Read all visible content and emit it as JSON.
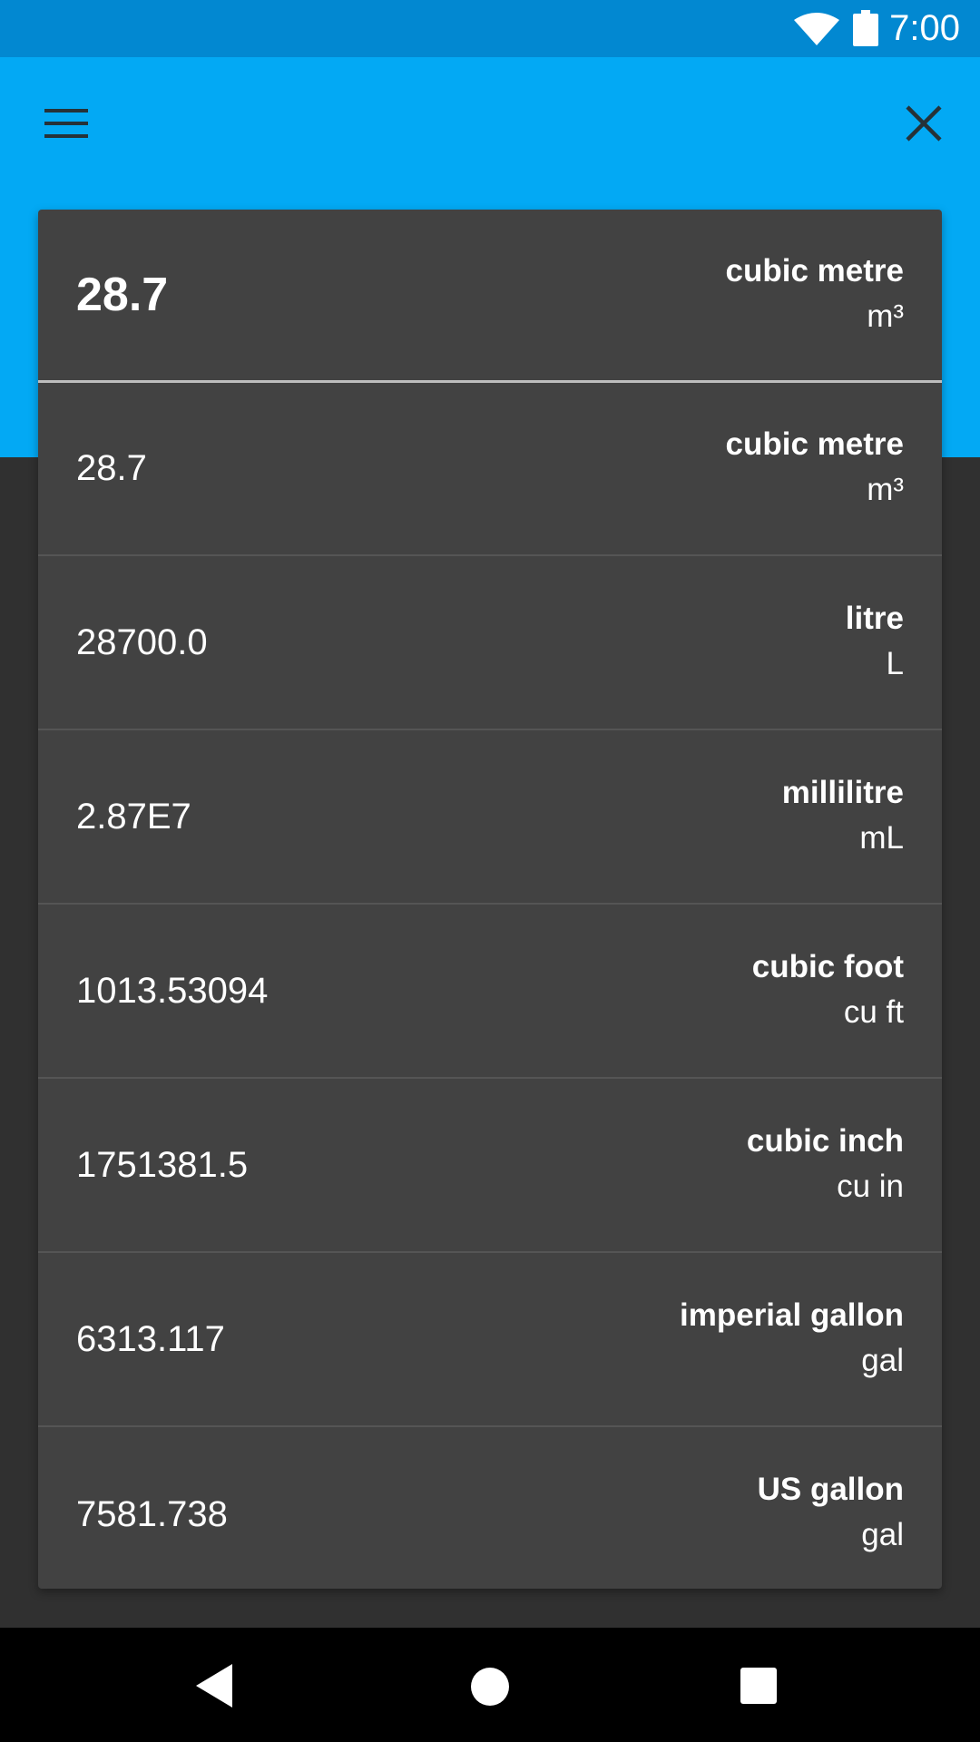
{
  "status_bar": {
    "time": "7:00",
    "icons": [
      "wifi-icon",
      "battery-icon"
    ],
    "color": "#0288D1"
  },
  "app_bar": {
    "color": "#03A9F4",
    "icons": [
      "menu-icon",
      "close-icon"
    ]
  },
  "conversion_input": {
    "value": "28.7",
    "unit_name": "cubic metre",
    "unit_symbol": "m³"
  },
  "results": [
    {
      "value": "28.7",
      "unit_name": "cubic metre",
      "unit_symbol": "m³"
    },
    {
      "value": "28700.0",
      "unit_name": "litre",
      "unit_symbol": "L"
    },
    {
      "value": "2.87E7",
      "unit_name": "millilitre",
      "unit_symbol": "mL"
    },
    {
      "value": "1013.53094",
      "unit_name": "cubic foot",
      "unit_symbol": "cu ft"
    },
    {
      "value": "1751381.5",
      "unit_name": "cubic inch",
      "unit_symbol": "cu in"
    },
    {
      "value": "6313.117",
      "unit_name": "imperial gallon",
      "unit_symbol": "gal"
    },
    {
      "value": "7581.738",
      "unit_name": "US gallon",
      "unit_symbol": "gal"
    }
  ],
  "nav_bar": {
    "icons": [
      "back-icon",
      "home-icon",
      "recents-icon"
    ]
  }
}
